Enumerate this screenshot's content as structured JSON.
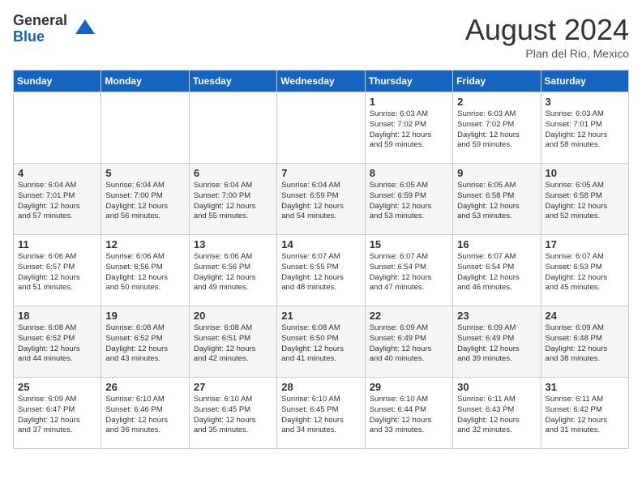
{
  "header": {
    "logo_general": "General",
    "logo_blue": "Blue",
    "title": "August 2024",
    "location": "Plan del Rio, Mexico"
  },
  "days_of_week": [
    "Sunday",
    "Monday",
    "Tuesday",
    "Wednesday",
    "Thursday",
    "Friday",
    "Saturday"
  ],
  "weeks": [
    [
      {
        "day": "",
        "info": ""
      },
      {
        "day": "",
        "info": ""
      },
      {
        "day": "",
        "info": ""
      },
      {
        "day": "",
        "info": ""
      },
      {
        "day": "1",
        "info": "Sunrise: 6:03 AM\nSunset: 7:02 PM\nDaylight: 12 hours\nand 59 minutes."
      },
      {
        "day": "2",
        "info": "Sunrise: 6:03 AM\nSunset: 7:02 PM\nDaylight: 12 hours\nand 59 minutes."
      },
      {
        "day": "3",
        "info": "Sunrise: 6:03 AM\nSunset: 7:01 PM\nDaylight: 12 hours\nand 58 minutes."
      }
    ],
    [
      {
        "day": "4",
        "info": "Sunrise: 6:04 AM\nSunset: 7:01 PM\nDaylight: 12 hours\nand 57 minutes."
      },
      {
        "day": "5",
        "info": "Sunrise: 6:04 AM\nSunset: 7:00 PM\nDaylight: 12 hours\nand 56 minutes."
      },
      {
        "day": "6",
        "info": "Sunrise: 6:04 AM\nSunset: 7:00 PM\nDaylight: 12 hours\nand 55 minutes."
      },
      {
        "day": "7",
        "info": "Sunrise: 6:04 AM\nSunset: 6:59 PM\nDaylight: 12 hours\nand 54 minutes."
      },
      {
        "day": "8",
        "info": "Sunrise: 6:05 AM\nSunset: 6:59 PM\nDaylight: 12 hours\nand 53 minutes."
      },
      {
        "day": "9",
        "info": "Sunrise: 6:05 AM\nSunset: 6:58 PM\nDaylight: 12 hours\nand 53 minutes."
      },
      {
        "day": "10",
        "info": "Sunrise: 6:05 AM\nSunset: 6:58 PM\nDaylight: 12 hours\nand 52 minutes."
      }
    ],
    [
      {
        "day": "11",
        "info": "Sunrise: 6:06 AM\nSunset: 6:57 PM\nDaylight: 12 hours\nand 51 minutes."
      },
      {
        "day": "12",
        "info": "Sunrise: 6:06 AM\nSunset: 6:56 PM\nDaylight: 12 hours\nand 50 minutes."
      },
      {
        "day": "13",
        "info": "Sunrise: 6:06 AM\nSunset: 6:56 PM\nDaylight: 12 hours\nand 49 minutes."
      },
      {
        "day": "14",
        "info": "Sunrise: 6:07 AM\nSunset: 6:55 PM\nDaylight: 12 hours\nand 48 minutes."
      },
      {
        "day": "15",
        "info": "Sunrise: 6:07 AM\nSunset: 6:54 PM\nDaylight: 12 hours\nand 47 minutes."
      },
      {
        "day": "16",
        "info": "Sunrise: 6:07 AM\nSunset: 6:54 PM\nDaylight: 12 hours\nand 46 minutes."
      },
      {
        "day": "17",
        "info": "Sunrise: 6:07 AM\nSunset: 6:53 PM\nDaylight: 12 hours\nand 45 minutes."
      }
    ],
    [
      {
        "day": "18",
        "info": "Sunrise: 6:08 AM\nSunset: 6:52 PM\nDaylight: 12 hours\nand 44 minutes."
      },
      {
        "day": "19",
        "info": "Sunrise: 6:08 AM\nSunset: 6:52 PM\nDaylight: 12 hours\nand 43 minutes."
      },
      {
        "day": "20",
        "info": "Sunrise: 6:08 AM\nSunset: 6:51 PM\nDaylight: 12 hours\nand 42 minutes."
      },
      {
        "day": "21",
        "info": "Sunrise: 6:08 AM\nSunset: 6:50 PM\nDaylight: 12 hours\nand 41 minutes."
      },
      {
        "day": "22",
        "info": "Sunrise: 6:09 AM\nSunset: 6:49 PM\nDaylight: 12 hours\nand 40 minutes."
      },
      {
        "day": "23",
        "info": "Sunrise: 6:09 AM\nSunset: 6:49 PM\nDaylight: 12 hours\nand 39 minutes."
      },
      {
        "day": "24",
        "info": "Sunrise: 6:09 AM\nSunset: 6:48 PM\nDaylight: 12 hours\nand 38 minutes."
      }
    ],
    [
      {
        "day": "25",
        "info": "Sunrise: 6:09 AM\nSunset: 6:47 PM\nDaylight: 12 hours\nand 37 minutes."
      },
      {
        "day": "26",
        "info": "Sunrise: 6:10 AM\nSunset: 6:46 PM\nDaylight: 12 hours\nand 36 minutes."
      },
      {
        "day": "27",
        "info": "Sunrise: 6:10 AM\nSunset: 6:45 PM\nDaylight: 12 hours\nand 35 minutes."
      },
      {
        "day": "28",
        "info": "Sunrise: 6:10 AM\nSunset: 6:45 PM\nDaylight: 12 hours\nand 34 minutes."
      },
      {
        "day": "29",
        "info": "Sunrise: 6:10 AM\nSunset: 6:44 PM\nDaylight: 12 hours\nand 33 minutes."
      },
      {
        "day": "30",
        "info": "Sunrise: 6:11 AM\nSunset: 6:43 PM\nDaylight: 12 hours\nand 32 minutes."
      },
      {
        "day": "31",
        "info": "Sunrise: 6:11 AM\nSunset: 6:42 PM\nDaylight: 12 hours\nand 31 minutes."
      }
    ]
  ]
}
